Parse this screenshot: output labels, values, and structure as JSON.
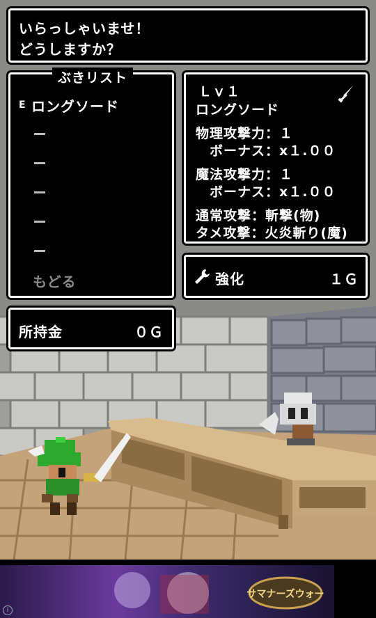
{
  "dialog": {
    "line1": "いらっしゃいませ！",
    "line2": "どうしますか？"
  },
  "weapon_list": {
    "title": "ぶきリスト",
    "equipped_mark": "E",
    "items": [
      "ロングソード"
    ],
    "empty_slot": "ー",
    "back_label": "もどる"
  },
  "details": {
    "level": "Ｌｖ１",
    "name": "ロングソード",
    "phys_attack": "物理攻撃力：１",
    "phys_bonus": "ボーナス：x１.００",
    "magic_attack": "魔法攻撃力：１",
    "magic_bonus": "ボーナス：x１.００",
    "normal_attack": "通常攻撃：斬撃(物)",
    "charge_attack": "タメ攻撃：火炎斬り(魔)"
  },
  "upgrade": {
    "label": "強化",
    "cost": "１Ｇ"
  },
  "money": {
    "label": "所持金",
    "value": "０Ｇ"
  },
  "ad": {
    "logo_text": "サマナーズウォー"
  },
  "colors": {
    "panel_bg": "#000000",
    "border": "#ffffff",
    "dim_text": "#8a8a8a"
  }
}
